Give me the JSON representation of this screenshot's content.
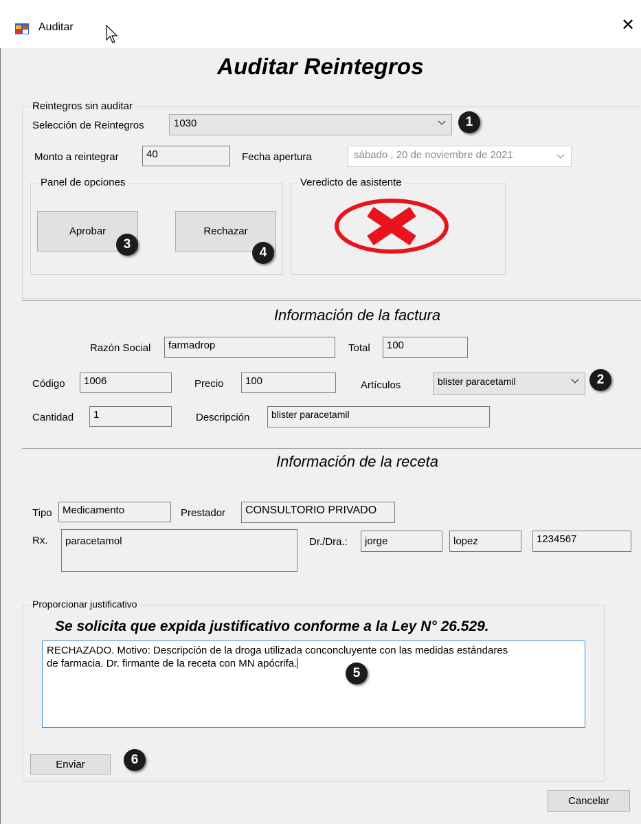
{
  "window": {
    "title": "Auditar",
    "close_symbol": "✕"
  },
  "heading": "Auditar Reintegros",
  "reintegros": {
    "group_label": "Reintegros sin auditar",
    "seleccion_label": "Selección de Reintegros",
    "seleccion_value": "1030",
    "monto_label": "Monto a reintegrar",
    "monto_value": "40",
    "fecha_label": "Fecha apertura",
    "fecha_value": "sábado  , 20 de noviembre de 2021"
  },
  "opciones": {
    "group_label": "Panel de opciones",
    "aprobar_label": "Aprobar",
    "rechazar_label": "Rechazar"
  },
  "veredicto": {
    "group_label": "Veredicto de asistente",
    "status": "rejected",
    "color": "#e8141d"
  },
  "factura": {
    "title": "Información de la factura",
    "razon_label": "Razón Social",
    "razon_value": "farmadrop",
    "total_label": "Total",
    "total_value": "100",
    "codigo_label": "Código",
    "codigo_value": "1006",
    "precio_label": "Precio",
    "precio_value": "100",
    "articulos_label": "Artículos",
    "articulos_value": "blister paracetamil",
    "cantidad_label": "Cantidad",
    "cantidad_value": "1",
    "descripcion_label": "Descripción",
    "descripcion_value": "blister paracetamil"
  },
  "receta": {
    "title": "Información de la receta",
    "tipo_label": "Tipo",
    "tipo_value": "Medicamento",
    "prestador_label": "Prestador",
    "prestador_value": "CONSULTORIO PRIVADO",
    "rx_label": "Rx.",
    "rx_value": "paracetamol",
    "dr_label": "Dr./Dra.:",
    "dr_nombre": "jorge",
    "dr_apellido": "lopez",
    "dr_matricula": "1234567"
  },
  "justificativo": {
    "group_label": "Proporcionar justificativo",
    "notice": "Se solicita que expida justificativo conforme a la Ley N° 26.529.",
    "text_line1": "RECHAZADO. Motivo: Descripción de la droga utilizada conconcluyente con las medidas estándares",
    "text_line2": "de farmacia. Dr. firmante de la receta con MN apócrifa.",
    "enviar_label": "Enviar"
  },
  "cancelar_label": "Cancelar",
  "badges": [
    "1",
    "2",
    "3",
    "4",
    "5",
    "6"
  ]
}
